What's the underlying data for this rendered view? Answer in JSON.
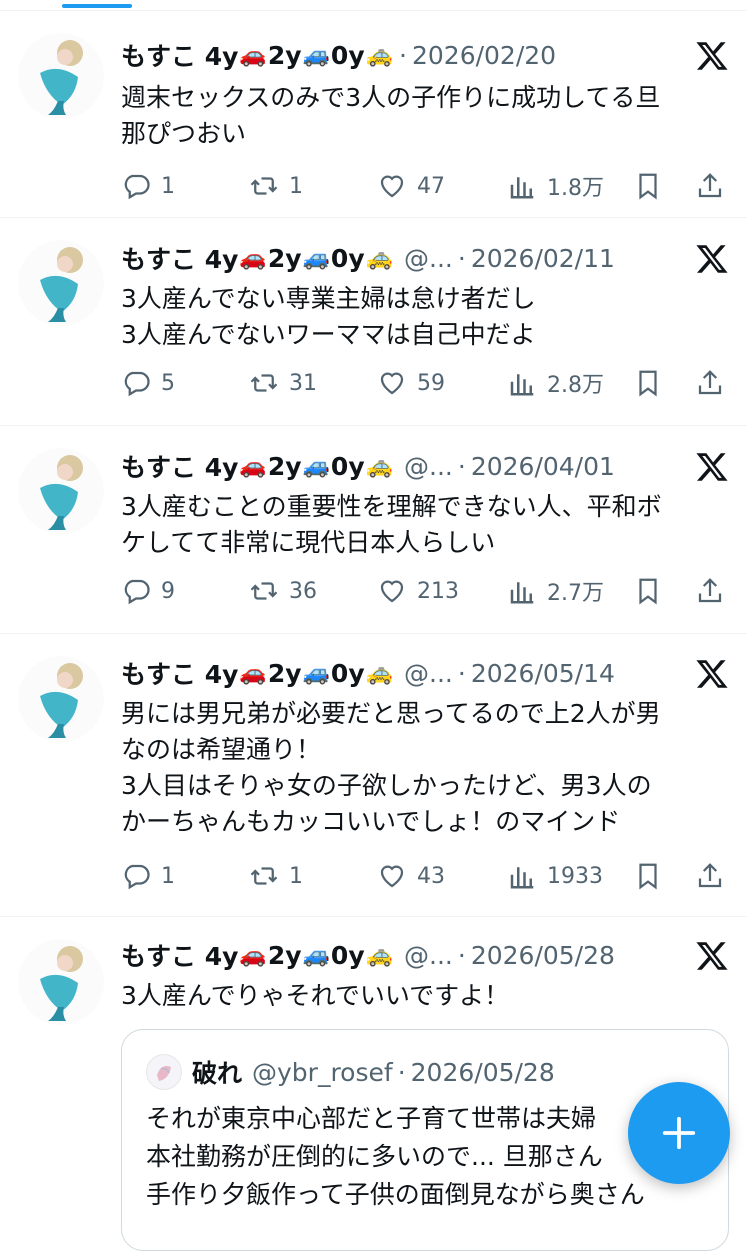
{
  "tweets": [
    {
      "name": "もすこ 4y",
      "car1": "🚗",
      "age2": "2y",
      "car2": "🚙",
      "age3": "0y",
      "car3": "🚕",
      "handle": "",
      "date": "2026/02/20",
      "text": "週末セックスのみで3人の子作りに成功してる旦\n那ぴつおい",
      "replies": "1",
      "retweets": "1",
      "likes": "47",
      "views": "1.8万"
    },
    {
      "name": "もすこ 4y",
      "car1": "🚗",
      "age2": "2y",
      "car2": "🚙",
      "age3": "0y",
      "car3": "🚕",
      "handle": "@...",
      "date": "2026/02/11",
      "text": "3人産んでない専業主婦は怠け者だし\n3人産んでないワーママは自己中だよ",
      "replies": "5",
      "retweets": "31",
      "likes": "59",
      "views": "2.8万"
    },
    {
      "name": "もすこ 4y",
      "car1": "🚗",
      "age2": "2y",
      "car2": "🚙",
      "age3": "0y",
      "car3": "🚕",
      "handle": "@...",
      "date": "2026/04/01",
      "text": "3人産むことの重要性を理解できない人、平和ボ\nケしてて非常に現代日本人らしい",
      "replies": "9",
      "retweets": "36",
      "likes": "213",
      "views": "2.7万"
    },
    {
      "name": "もすこ 4y",
      "car1": "🚗",
      "age2": "2y",
      "car2": "🚙",
      "age3": "0y",
      "car3": "🚕",
      "handle": "@...",
      "date": "2026/05/14",
      "text": "男には男兄弟が必要だと思ってるので上2人が男\nなのは希望通り！\n3人目はそりゃ女の子欲しかったけど、男3人の\nかーちゃんもカッコいいでしょ！のマインド",
      "replies": "1",
      "retweets": "1",
      "likes": "43",
      "views": "1933"
    },
    {
      "name": "もすこ 4y",
      "car1": "🚗",
      "age2": "2y",
      "car2": "🚙",
      "age3": "0y",
      "car3": "🚕",
      "handle": "@...",
      "date": "2026/05/28",
      "text": "3人産んでりゃそれでいいですよ！",
      "quote": {
        "name": "破れ",
        "handle": "@ybr_rosef",
        "date": "2026/05/28",
        "text": "それが東京中心部だと子育て世帯は夫婦\n本社勤務が圧倒的に多いので... 旦那さん\n手作り夕飯作って子供の面倒見ながら奥さん"
      }
    }
  ],
  "separator_dot": "·",
  "fab": {
    "icon": "plus-icon"
  },
  "colors": {
    "accent": "#1d9bf0",
    "muted": "#536471",
    "text": "#0f1419",
    "border": "#eff3f4"
  }
}
